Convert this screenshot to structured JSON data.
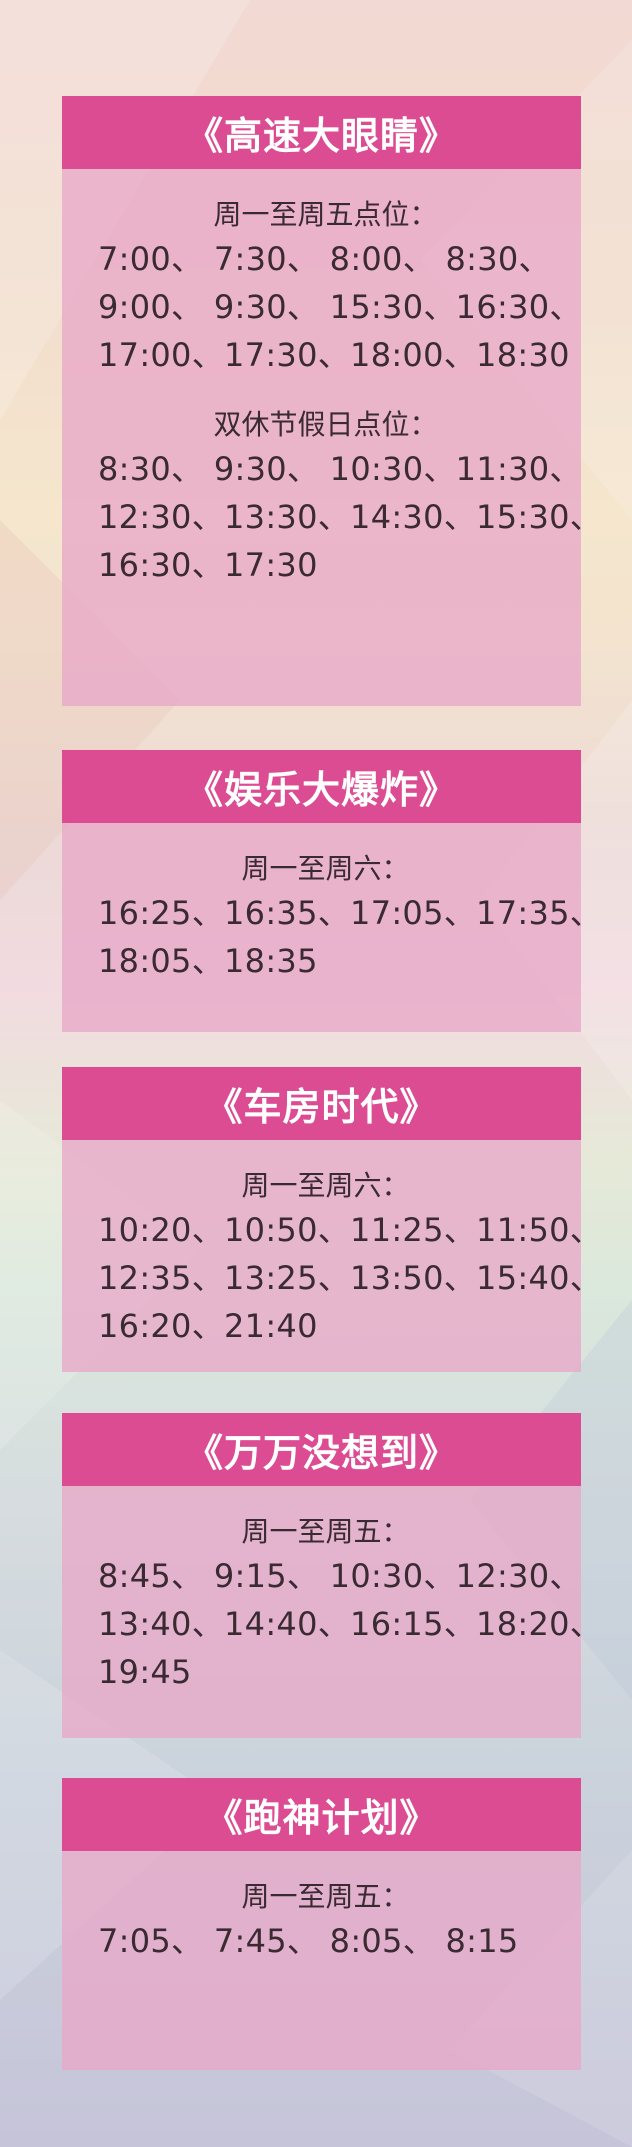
{
  "background_colors": [
    "#f2d9d3",
    "#f5e6cd",
    "#f2dbe0",
    "#dbe8dc",
    "#cbd3dc",
    "#c6c4d9"
  ],
  "accent_color": "#dc4c93",
  "cards": [
    {
      "title": "《高速大眼睛》",
      "groups": [
        {
          "label": "周一至周五点位：",
          "rows": [
            "7:00、 7:30、 8:00、 8:30、",
            "9:00、 9:30、 15:30、16:30、",
            "17:00、17:30、18:00、18:30"
          ]
        },
        {
          "label": "双休节假日点位：",
          "rows": [
            "8:30、 9:30、 10:30、11:30、",
            "12:30、13:30、14:30、15:30、",
            "16:30、17:30"
          ]
        }
      ]
    },
    {
      "title": "《娱乐大爆炸》",
      "groups": [
        {
          "label": "周一至周六：",
          "rows": [
            "16:25、16:35、17:05、17:35、",
            "18:05、18:35"
          ]
        }
      ]
    },
    {
      "title": "《车房时代》",
      "groups": [
        {
          "label": "周一至周六：",
          "rows": [
            "10:20、10:50、11:25、11:50、",
            "12:35、13:25、13:50、15:40、",
            "16:20、21:40"
          ]
        }
      ]
    },
    {
      "title": "《万万没想到》",
      "groups": [
        {
          "label": "周一至周五：",
          "rows": [
            "8:45、 9:15、 10:30、12:30、",
            "13:40、14:40、16:15、18:20、",
            "19:45"
          ]
        }
      ]
    },
    {
      "title": "《跑神计划》",
      "groups": [
        {
          "label": "周一至周五：",
          "rows": [
            "7:05、 7:45、 8:05、 8:15"
          ]
        }
      ]
    }
  ]
}
